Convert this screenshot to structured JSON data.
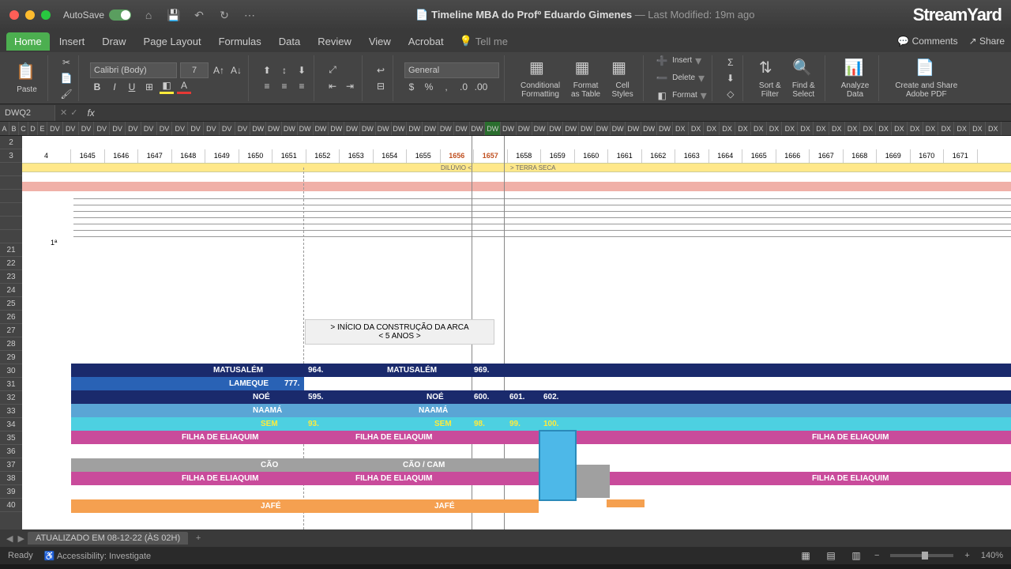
{
  "titlebar": {
    "autosave_label": "AutoSave",
    "doc_title": "Timeline MBA do Profº Eduardo Gimenes",
    "modified": "— Last Modified: 19m ago",
    "brand": "StreamYard",
    "comments": "Comments",
    "share": "Share"
  },
  "tabs": {
    "home": "Home",
    "insert": "Insert",
    "draw": "Draw",
    "layout": "Page Layout",
    "formulas": "Formulas",
    "data": "Data",
    "review": "Review",
    "view": "View",
    "acrobat": "Acrobat",
    "tellme": "Tell me"
  },
  "ribbon": {
    "paste": "Paste",
    "font_name": "Calibri (Body)",
    "font_size": "7",
    "number_format": "General",
    "cond_fmt": "Conditional\nFormatting",
    "fmt_table": "Format\nas Table",
    "cell_styles": "Cell\nStyles",
    "insert": "Insert",
    "delete": "Delete",
    "format": "Format",
    "sort": "Sort &\nFilter",
    "find": "Find &\nSelect",
    "analyze": "Analyze\nData",
    "pdf": "Create and Share\nAdobe PDF"
  },
  "namebox": "DWQ2",
  "col_letters": [
    "A",
    "B",
    "C",
    "D",
    "E",
    "DV",
    "DV",
    "DV",
    "DV",
    "DV",
    "DV",
    "DV",
    "DV",
    "DV",
    "DV",
    "DV",
    "DV",
    "DV",
    "DW",
    "DW",
    "DW",
    "DW",
    "DW",
    "DW",
    "DW",
    "DW",
    "DW",
    "DW",
    "DW",
    "DW",
    "DW",
    "DW",
    "DW",
    "DW",
    "DW",
    "DW",
    "DW",
    "DW",
    "DW",
    "DW",
    "DW",
    "DW",
    "DW",
    "DW",
    "DW",
    "DX",
    "DX",
    "DX",
    "DX",
    "DX",
    "DX",
    "DX",
    "DX",
    "DX",
    "DX",
    "DX",
    "DX",
    "DX",
    "DX",
    "DX",
    "DX",
    "DX",
    "DX",
    "DX",
    "DX",
    "DX"
  ],
  "row_nums": [
    "2",
    "3",
    "",
    "",
    "",
    "",
    "",
    "",
    "21",
    "22",
    "23",
    "24",
    "25",
    "26",
    "27",
    "28",
    "29",
    "30",
    "31",
    "32",
    "33",
    "34",
    "35",
    "36",
    "37",
    "38",
    "39",
    "40"
  ],
  "years": [
    "4",
    "1645",
    "1646",
    "1647",
    "1648",
    "1649",
    "1650",
    "1651",
    "1652",
    "1653",
    "1654",
    "1655",
    "1656",
    "1657",
    "1658",
    "1659",
    "1660",
    "1661",
    "1662",
    "1663",
    "1664",
    "1665",
    "1666",
    "1667",
    "1668",
    "1669",
    "1670",
    "1671"
  ],
  "hl_years": [
    "1656",
    "1657"
  ],
  "labels": {
    "diluvio": "DILÚVIO <",
    "terra": "> TERRA SECA",
    "n18": "1ª",
    "arca1": "> INÍCIO DA CONSTRUÇÃO DA ARCA",
    "arca2": "< 5 ANOS >"
  },
  "bars": {
    "matusalem": "MATUSALÉM",
    "matusalem_v1": "964.",
    "matusalem_v2": "969.",
    "lameque": "LAMEQUE",
    "lameque_v": "777.",
    "noe": "NOÉ",
    "noe_v1": "595.",
    "noe_v2": "600.",
    "noe_v3": "601.",
    "noe_v4": "602.",
    "naama": "NAAMÁ",
    "sem": "SEM",
    "sem_v1": "93.",
    "sem_v2": "98.",
    "sem_v3": "99.",
    "sem_v4": "100.",
    "filha": "FILHA DE ELIAQUIM",
    "cao": "CÃO",
    "cao_cam": "CÃO / CAM",
    "jafe": "JAFÉ"
  },
  "sheettab": "ATUALIZADO EM 08-12-22 (ÀS 02H)",
  "status": {
    "ready": "Ready",
    "access": "Accessibility: Investigate",
    "zoom": "140%"
  }
}
